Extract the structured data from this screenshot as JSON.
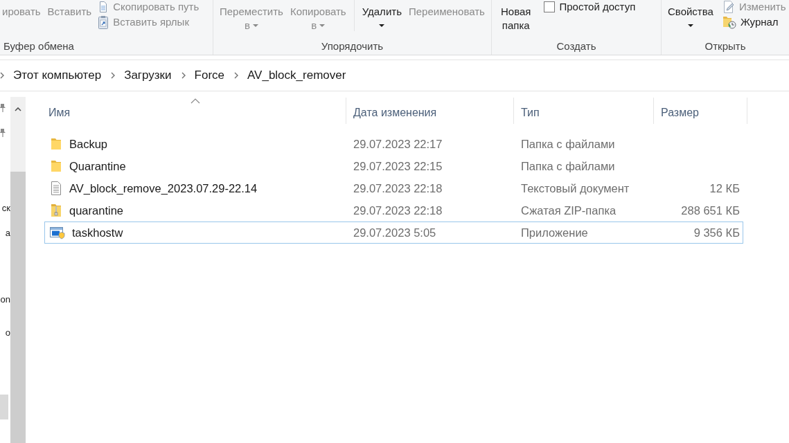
{
  "ribbon": {
    "groups": [
      {
        "label": "Буфер обмена",
        "items": [
          {
            "kind": "large",
            "lines": [
              "ировать"
            ],
            "dropdown": false,
            "disabled": true
          },
          {
            "kind": "large",
            "lines": [
              "Вставить"
            ],
            "dropdown": false,
            "disabled": true
          },
          {
            "kind": "stack",
            "items": [
              {
                "kind": "copy_path",
                "label": "Скопировать путь",
                "disabled": true
              },
              {
                "kind": "paste_shortcut",
                "label": "Вставить ярлык",
                "disabled": true
              }
            ]
          }
        ]
      },
      {
        "label": "Упорядочить",
        "items": [
          {
            "kind": "large",
            "lines": [
              "Переместить",
              "в"
            ],
            "dropdown": true,
            "disabled": true
          },
          {
            "kind": "large",
            "lines": [
              "Копировать",
              "в"
            ],
            "dropdown": true,
            "disabled": true
          },
          {
            "kind": "separator"
          },
          {
            "kind": "large",
            "lines": [
              "Удалить"
            ],
            "dropdown": true,
            "disabled": false
          },
          {
            "kind": "large",
            "lines": [
              "Переименовать"
            ],
            "dropdown": false,
            "disabled": true
          }
        ]
      },
      {
        "label": "Создать",
        "items": [
          {
            "kind": "large",
            "lines": [
              "Новая",
              "папка"
            ],
            "dropdown": false,
            "disabled": false
          },
          {
            "kind": "stack",
            "items": [
              {
                "kind": "easy_access",
                "label": "Простой доступ",
                "disabled": false
              }
            ]
          }
        ]
      },
      {
        "label": "Открыть",
        "items": [
          {
            "kind": "large",
            "lines": [
              "Свойства"
            ],
            "dropdown": true,
            "disabled": false
          },
          {
            "kind": "stack",
            "items": [
              {
                "kind": "edit",
                "label": "Изменить",
                "disabled": true
              },
              {
                "kind": "history",
                "label": "Журнал",
                "disabled": false
              }
            ]
          }
        ]
      }
    ]
  },
  "address_bar": {
    "crumbs": [
      "Этот компьютер",
      "Загрузки",
      "Force",
      "AV_block_remover"
    ]
  },
  "navigation_pane": {
    "items": [
      {
        "pinned": true,
        "selected": false
      },
      {
        "pinned": true,
        "selected": false
      },
      {
        "text": "ск",
        "pinned": false,
        "selected": false
      },
      {
        "text": "а",
        "pinned": false,
        "selected": false
      },
      {
        "text": "on",
        "pinned": false,
        "selected": false
      },
      {
        "text": "о",
        "pinned": false,
        "selected": false
      },
      {
        "pinned": false,
        "selected": true
      }
    ]
  },
  "file_list": {
    "columns": [
      {
        "label": "Имя",
        "sorted": true
      },
      {
        "label": "Дата изменения",
        "sorted": false
      },
      {
        "label": "Тип",
        "sorted": false
      },
      {
        "label": "Размер",
        "sorted": false
      }
    ],
    "rows": [
      {
        "kind": "folder",
        "name": "Backup",
        "date": "29.07.2023 22:17",
        "type": "Папка с файлами",
        "focused": false
      },
      {
        "kind": "folder",
        "name": "Quarantine",
        "date": "29.07.2023 22:15",
        "type": "Папка с файлами",
        "focused": false
      },
      {
        "kind": "text",
        "name": "AV_block_remove_2023.07.29-22.14",
        "date": "29.07.2023 22:18",
        "type": "Текстовый документ",
        "size": "12 КБ",
        "focused": false
      },
      {
        "kind": "zip",
        "name": "quarantine",
        "date": "29.07.2023 22:18",
        "type": "Сжатая ZIP-папка",
        "size": "288 651 КБ",
        "focused": false
      },
      {
        "kind": "app",
        "name": "taskhostw",
        "date": "29.07.2023 5:05",
        "type": "Приложение",
        "size": "9 356 КБ",
        "focused": true
      }
    ]
  }
}
